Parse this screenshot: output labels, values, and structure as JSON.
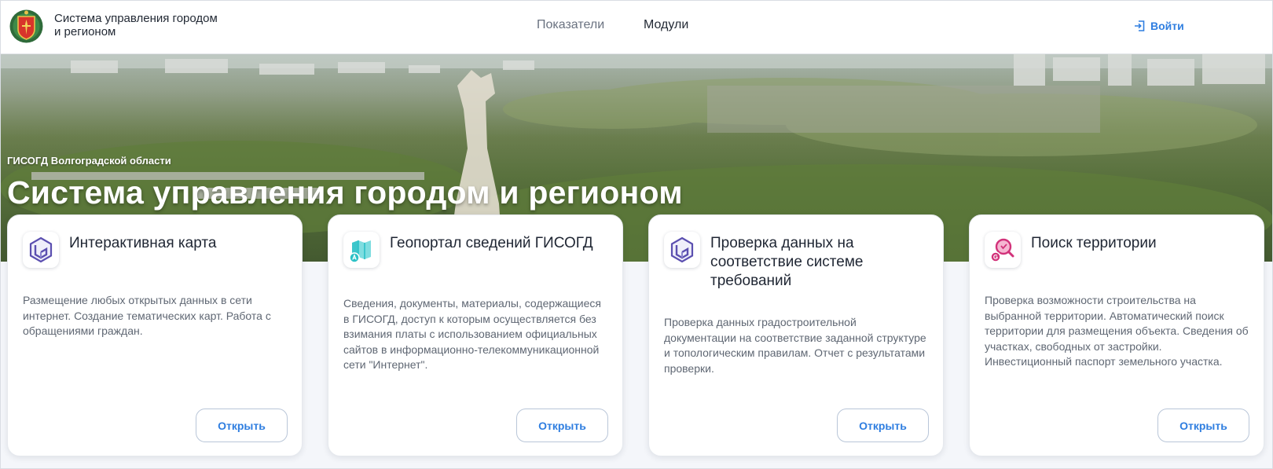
{
  "header": {
    "brand_line1": "Система управления городом",
    "brand_line2": "и регионом",
    "nav": [
      {
        "label": "Показатели"
      },
      {
        "label": "Модули"
      }
    ],
    "login_label": "Войти"
  },
  "hero": {
    "subtitle": "ГИСОГД Волгоградской области",
    "title": "Система управления городом и регионом"
  },
  "cards": [
    {
      "title": "Интерактивная карта",
      "description": "Размещение любых открытых данных в сети интернет. Создание тематических карт. Работа с обращениями граждан.",
      "button": "Открыть",
      "icon": "interactive-map-icon"
    },
    {
      "title": "Геопортал сведений ГИСОГД",
      "description": "Сведения, документы, материалы, содержащиеся в ГИСОГД, доступ к которым осуществляется без взимания платы с использованием официальных сайтов в информационно-телекоммуникационной сети \"Интернет\".",
      "button": "Открыть",
      "icon": "geoportal-icon"
    },
    {
      "title": "Проверка данных на соответствие системе требований",
      "description": "Проверка данных градостроительной документации на соответствие заданной структуре и топологическим правилам. Отчет с результатами проверки.",
      "button": "Открыть",
      "icon": "data-check-icon"
    },
    {
      "title": "Поиск территории",
      "description": "Проверка возможности строительства на выбранной территории. Автоматический поиск территории для размещения объекта. Сведения об участках, свободных от застройки. Инвестиционный паспорт земельного участка.",
      "button": "Открыть",
      "icon": "territory-search-icon"
    }
  ],
  "colors": {
    "accent": "#2f7ee0",
    "purple_icon": "#5b4fb0",
    "teal_icon": "#2cc1c6",
    "magenta_icon": "#d2327a"
  }
}
